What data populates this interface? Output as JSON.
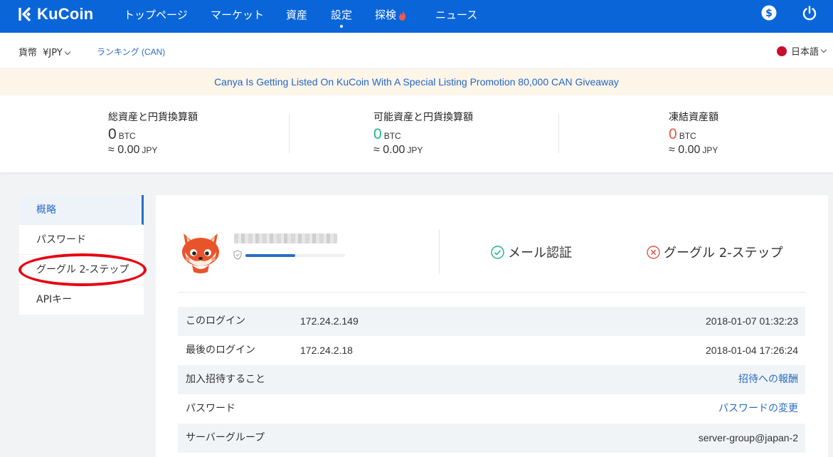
{
  "brand": {
    "name": "KuCoin"
  },
  "nav": {
    "items": [
      {
        "label": "トップページ"
      },
      {
        "label": "マーケット"
      },
      {
        "label": "資産"
      },
      {
        "label": "設定"
      },
      {
        "label": "探検"
      },
      {
        "label": "ニュース"
      }
    ],
    "active_index": 3,
    "icons": [
      "dollar-icon",
      "power-icon"
    ]
  },
  "subbar": {
    "currency_label": "貨幣",
    "currency_value": "¥JPY",
    "ranking": "ランキング (CAN)",
    "language": "日本語"
  },
  "banner": {
    "text": "Canya Is Getting Listed On KuCoin With A Special Listing Promotion 80,000 CAN Giveaway"
  },
  "summary": [
    {
      "label": "総資産と円貨換算額",
      "value": "0",
      "unit": "BTC",
      "approx": "≈ 0.00",
      "approx_unit": "JPY",
      "color": "#333333"
    },
    {
      "label": "可能資産と円貨換算額",
      "value": "0",
      "unit": "BTC",
      "approx": "≈ 0.00",
      "approx_unit": "JPY",
      "color": "#1fb58a"
    },
    {
      "label": "凍結資産額",
      "value": "0",
      "unit": "BTC",
      "approx": "≈ 0.00",
      "approx_unit": "JPY",
      "color": "#e2574c"
    }
  ],
  "sidebar": {
    "items": [
      {
        "label": "概略",
        "active": true
      },
      {
        "label": "パスワード",
        "active": false
      },
      {
        "label": "グーグル 2-ステップ",
        "active": false
      },
      {
        "label": "APIキー",
        "active": false
      }
    ]
  },
  "profile": {
    "security_level": 0.5,
    "email_verification": "メール認証",
    "google_2step": "グーグル 2-ステップ"
  },
  "info_rows": [
    {
      "label": "このログイン",
      "ip": "172.24.2.149",
      "value": "2018-01-07 01:32:23"
    },
    {
      "label": "最後のログイン",
      "ip": "172.24.2.18",
      "value": "2018-01-04 17:26:24"
    },
    {
      "label": "加入招待すること",
      "link": "招待への報酬"
    },
    {
      "label": "パスワード",
      "link": "パスワードの変更"
    },
    {
      "label": "サーバーグループ",
      "value": "server-group@japan-2"
    }
  ],
  "colors": {
    "brand_blue": "#0a66d8",
    "link_blue": "#2b6cc4",
    "highlight_red": "#e60012"
  }
}
